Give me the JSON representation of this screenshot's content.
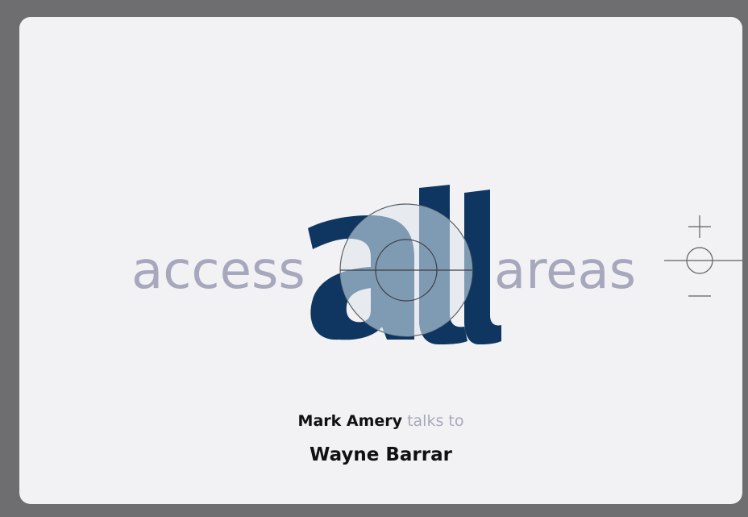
{
  "title": {
    "word_left": "access",
    "logo_text": "all",
    "word_right": "areas"
  },
  "credits": {
    "host": "Mark Amery",
    "connector": "talks to",
    "guest": "Wayne Barrar"
  },
  "icons": {
    "zoom_control": "zoom-slider-icon"
  },
  "colors": {
    "background": "#6e6e70",
    "card": "#f2f2f4",
    "grey_text": "#a7a8bd",
    "navy": "#0f3660",
    "steel": "#7f9ab3",
    "dark_text": "#111111"
  }
}
